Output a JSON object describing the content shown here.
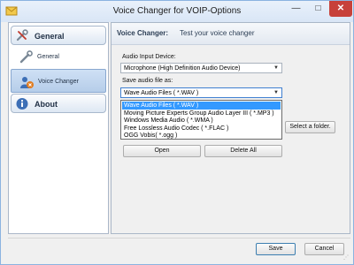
{
  "window": {
    "title": "Voice Changer for VOIP-Options",
    "minimize": "—",
    "maximize": "□",
    "close": "✕"
  },
  "sidebar": {
    "categories": [
      {
        "label": "General",
        "icon": "tools-icon"
      },
      {
        "label": "About",
        "icon": "info-icon"
      }
    ],
    "items": [
      {
        "label": "General",
        "icon": "wrench-icon",
        "active": false
      },
      {
        "label": "Voice Changer",
        "icon": "voice-changer-icon",
        "active": true
      }
    ]
  },
  "panel": {
    "title": "Voice Changer:",
    "subtitle": "Test your voice changer",
    "input_device_label": "Audio Input Device:",
    "input_device_value": "Microphone (High Definition Audio Device)",
    "save_as_label": "Save audio file as:",
    "save_as_value": "Wave Audio Files ( *.WAV )",
    "save_as_options": [
      "Wave Audio Files ( *.WAV )",
      "Moving Picture Experts Group Audio Layer III ( *.MP3 )",
      "Windows Media Audio ( *.WMA )",
      "Free Lossless Audio Codec ( *.FLAC )",
      "OGG Vobis( *.ogg )"
    ],
    "select_folder": "Select a folder.",
    "open": "Open",
    "delete_all": "Delete All"
  },
  "footer": {
    "save": "Save",
    "cancel": "Cancel"
  },
  "colors": {
    "selection": "#3399ff",
    "close_button": "#c7413a",
    "title_bar": "#dbe7f6"
  }
}
